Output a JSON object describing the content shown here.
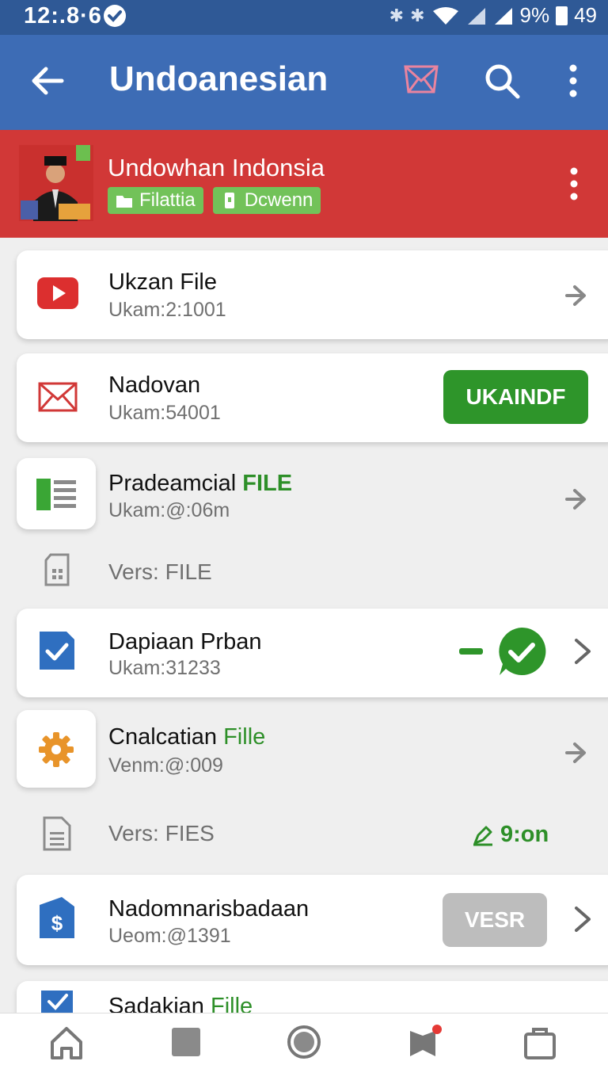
{
  "status_bar": {
    "time": "12:.8·6",
    "battery_percent": "9%",
    "right_number": "49"
  },
  "app_bar": {
    "title": "Undoanesian"
  },
  "banner": {
    "title": "Undowhan Indonsia",
    "chips": [
      {
        "label": "Filattia"
      },
      {
        "label": "Dcwenn"
      }
    ]
  },
  "rows": [
    {
      "title": "Ukzan File",
      "subtitle": "Ukam:2:1001",
      "icon": "youtube-icon"
    },
    {
      "title": "Nadovan",
      "subtitle": "Ukam:54001",
      "icon": "mail-icon",
      "button": "UKAINDF"
    },
    {
      "title": "Pradeamcial",
      "title_accent": "FILE",
      "subtitle": "Ukam:@:06m",
      "icon": "document-icon"
    },
    {
      "title": "Vers:  FILE",
      "icon": "sim-card-icon"
    },
    {
      "title": "Dapiaan Prban",
      "subtitle": "Ukam:31233",
      "icon": "checkbox-icon",
      "status_icon": "check-bubble-icon"
    },
    {
      "title": "Cnalcatian",
      "title_accent": "Fille",
      "subtitle": "Venm:@:009",
      "icon": "gear-icon"
    },
    {
      "title": "Vers:  FIES",
      "icon": "file-icon",
      "status": "9:on"
    },
    {
      "title": "Nadomnarisbadaan",
      "subtitle": "Ueom:@1391",
      "icon": "dollar-file-icon",
      "button": "VESR"
    },
    {
      "title": "Sadakian",
      "title_accent": "Fille",
      "icon": "checkbox-icon"
    }
  ],
  "bottom_nav": [
    "home-icon",
    "square-icon",
    "circle-icon",
    "flag-icon",
    "bag-icon"
  ],
  "colors": {
    "status_bar": "#2f5996",
    "app_bar": "#3d6cb5",
    "banner": "#d13837",
    "accent_green": "#2e952a",
    "chip_green": "#72c259",
    "button_gray": "#bdbdbd"
  }
}
